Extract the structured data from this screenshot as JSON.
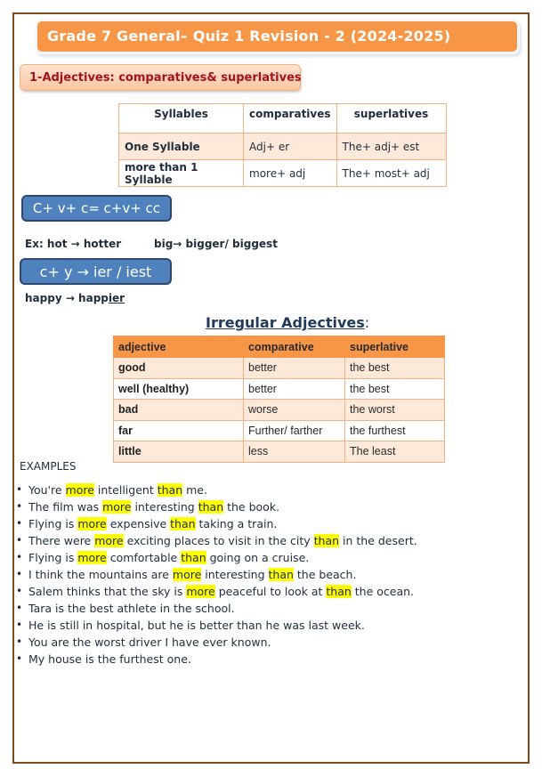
{
  "title": "Grade 7 General– Quiz 1 Revision - 2 (2024-2025)",
  "section_heading": "1-Adjectives: comparatives& superlatives",
  "rules_table": {
    "headers": [
      "Syllables",
      "comparatives",
      "superlatives"
    ],
    "rows": [
      [
        "One Syllable",
        "Adj+ er",
        "The+ adj+ est"
      ],
      [
        "more than 1 Syllable",
        "more+ adj",
        "The+ most+ adj"
      ]
    ]
  },
  "rule_cvc": "C+ v+ c= c+v+ cc",
  "rule_cvc_examples": {
    "ex1": "Ex:  hot → hotter",
    "ex2": "big→ bigger/ biggest"
  },
  "rule_cy": "c+ y → ier / iest",
  "rule_cy_example": {
    "prefix": "happy → happ",
    "underlined": "ier"
  },
  "irregular": {
    "title": "Irregular Adjectives",
    "colon": ":",
    "headers": [
      "adjective",
      "comparative",
      "superlative"
    ],
    "rows": [
      [
        "good",
        "better",
        "the best"
      ],
      [
        "well (healthy)",
        "better",
        "the best"
      ],
      [
        "bad",
        "worse",
        "the worst"
      ],
      [
        "far",
        "Further/ farther",
        "the furthest"
      ],
      [
        "little",
        "less",
        "The least"
      ]
    ]
  },
  "examples_label": "EXAMPLES",
  "examples": [
    {
      "parts": [
        [
          "You're ",
          false
        ],
        [
          "more",
          true
        ],
        [
          " intelligent ",
          false
        ],
        [
          "than",
          true
        ],
        [
          " me.",
          false
        ]
      ]
    },
    {
      "parts": [
        [
          "The film was ",
          false
        ],
        [
          "more",
          true
        ],
        [
          " interesting ",
          false
        ],
        [
          "than",
          true
        ],
        [
          " the book.",
          false
        ]
      ]
    },
    {
      "parts": [
        [
          "Flying is ",
          false
        ],
        [
          "more",
          true
        ],
        [
          " expensive ",
          false
        ],
        [
          "than",
          true
        ],
        [
          " taking a train.",
          false
        ]
      ]
    },
    {
      "parts": [
        [
          "There were ",
          false
        ],
        [
          "more",
          true
        ],
        [
          " exciting places to visit in the city ",
          false
        ],
        [
          "than",
          true
        ],
        [
          " in the desert.",
          false
        ]
      ]
    },
    {
      "parts": [
        [
          "Flying is ",
          false
        ],
        [
          "more",
          true
        ],
        [
          " comfortable ",
          false
        ],
        [
          "than",
          true
        ],
        [
          " going on a cruise.",
          false
        ]
      ]
    },
    {
      "parts": [
        [
          "I think the mountains are ",
          false
        ],
        [
          "more",
          true
        ],
        [
          " interesting ",
          false
        ],
        [
          "than",
          true
        ],
        [
          " the beach.",
          false
        ]
      ]
    },
    {
      "parts": [
        [
          "Salem thinks that the sky is ",
          false
        ],
        [
          "more",
          true
        ],
        [
          " peaceful to look at ",
          false
        ],
        [
          "than",
          true
        ],
        [
          " the ocean.",
          false
        ]
      ]
    },
    {
      "parts": [
        [
          "Tara is the best athlete in the school.",
          false
        ]
      ]
    },
    {
      "parts": [
        [
          "He is still in hospital, but he is better than he was last week.",
          false
        ]
      ]
    },
    {
      "parts": [
        [
          "You are the worst driver I have ever known.",
          false
        ]
      ]
    },
    {
      "parts": [
        [
          "My house is the furthest one.",
          false
        ]
      ]
    }
  ],
  "colors": {
    "title_bar": "#f79646",
    "section_text": "#a5141b",
    "rule_box": "#4f81bd",
    "table_tint": "#fde9d9",
    "highlight": "#ffff00",
    "page_border": "#7a4a1a"
  }
}
